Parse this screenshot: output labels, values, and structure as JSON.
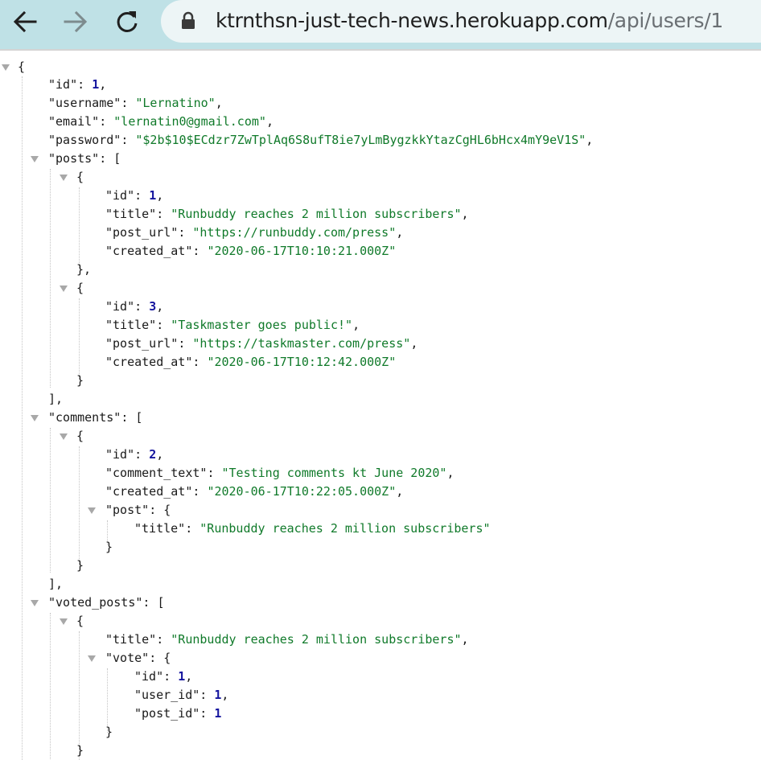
{
  "browser": {
    "back_icon": "arrow-left-icon",
    "forward_icon": "arrow-right-icon",
    "reload_icon": "reload-icon",
    "lock_icon": "lock-icon",
    "url_host": "ktrnthsn-just-tech-news.herokuapp.com",
    "url_path": "/api/users/1"
  },
  "json": {
    "id": "1",
    "username": "\"Lernatino\"",
    "email": "\"lernatin0@gmail.com\"",
    "password": "\"$2b$10$ECdzr7ZwTplAq6S8ufT8ie7yLmBygzkkYtazCgHL6bHcx4mY9eV1S\"",
    "posts": [
      {
        "id": "1",
        "title": "\"Runbuddy reaches 2 million subscribers\"",
        "post_url": "\"https://runbuddy.com/press\"",
        "created_at": "\"2020-06-17T10:10:21.000Z\""
      },
      {
        "id": "3",
        "title": "\"Taskmaster goes public!\"",
        "post_url": "\"https://taskmaster.com/press\"",
        "created_at": "\"2020-06-17T10:12:42.000Z\""
      }
    ],
    "comments": [
      {
        "id": "2",
        "comment_text": "\"Testing comments kt June 2020\"",
        "created_at": "\"2020-06-17T10:22:05.000Z\"",
        "post_title": "\"Runbuddy reaches 2 million subscribers\""
      }
    ],
    "voted_posts": [
      {
        "title": "\"Runbuddy reaches 2 million subscribers\"",
        "vote_id": "1",
        "vote_user_id": "1",
        "vote_post_id": "1"
      }
    ]
  },
  "keys": {
    "id": "\"id\"",
    "username": "\"username\"",
    "email": "\"email\"",
    "password": "\"password\"",
    "posts": "\"posts\"",
    "title": "\"title\"",
    "post_url": "\"post_url\"",
    "created_at": "\"created_at\"",
    "comments": "\"comments\"",
    "comment_text": "\"comment_text\"",
    "post": "\"post\"",
    "voted_posts": "\"voted_posts\"",
    "vote": "\"vote\"",
    "user_id": "\"user_id\"",
    "post_id": "\"post_id\""
  },
  "colors": {
    "toolbar_bg": "#bfe1e6",
    "string": "#107a2a",
    "number": "#15159e"
  }
}
